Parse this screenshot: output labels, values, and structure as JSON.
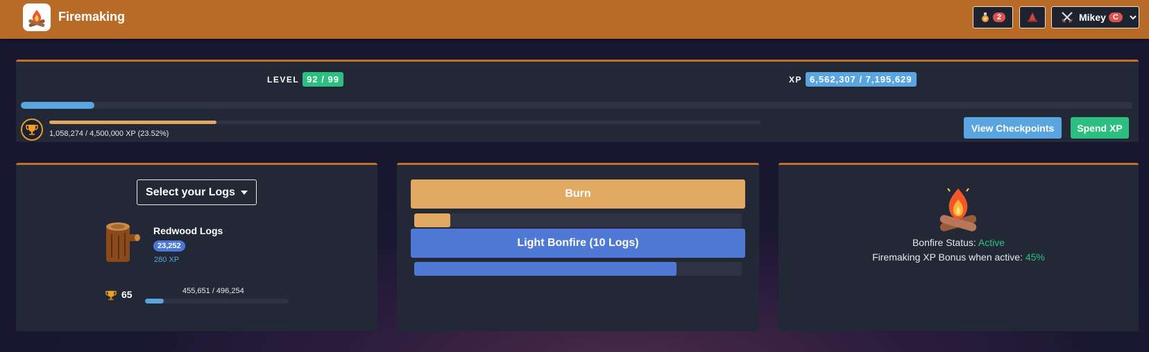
{
  "header": {
    "title": "Firemaking",
    "notifications_count": "2",
    "user_name": "Mikey",
    "user_badge": "C"
  },
  "skill": {
    "level_label": "LEVEL",
    "level_value": "92 / 99",
    "level_progress": 0.066,
    "xp_label": "XP",
    "xp_value": "6,562,307 / 7,195,629",
    "mastery_text": "1,058,274 / 4,500,000 XP (23.52%)",
    "mastery_progress": 0.2352,
    "view_checkpoints_label": "View Checkpoints",
    "spend_xp_label": "Spend XP"
  },
  "logs": {
    "select_label": "Select your Logs",
    "name": "Redwood Logs",
    "quantity": "23,252",
    "xp": "280 XP",
    "mastery_level": "65",
    "mastery_text": "455,651 / 496,254",
    "mastery_progress": 0.13
  },
  "actions": {
    "burn_label": "Burn",
    "burn_progress": 0.11,
    "bonfire_label": "Light Bonfire (10 Logs)",
    "bonfire_progress": 0.8
  },
  "bonfire": {
    "status_label": "Bonfire Status:",
    "status_value": "Active",
    "bonus_label": "Firemaking XP Bonus when active:",
    "bonus_value": "45%"
  },
  "colors": {
    "header": "#b86a27",
    "panel": "#222835",
    "accent_green": "#2bbf80",
    "accent_blue": "#5aa5e0",
    "burn": "#e2a963",
    "bonfire": "#5079d6",
    "active_text": "#2bc47d"
  }
}
